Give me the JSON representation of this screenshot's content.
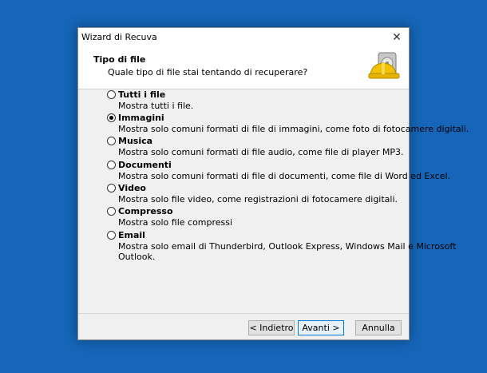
{
  "window": {
    "title": "Wizard di Recuva",
    "close_glyph": "✕"
  },
  "header": {
    "title": "Tipo di file",
    "subtitle": "Quale tipo di file stai tentando di recuperare?",
    "logo_icon": "recuva-hard-drive-helmet-icon"
  },
  "options": [
    {
      "label": "Tutti i file",
      "desc": "Mostra tutti i file.",
      "selected": false
    },
    {
      "label": "Immagini",
      "desc": "Mostra solo comuni formati di file di immagini, come foto di fotocamere digitali.",
      "selected": true
    },
    {
      "label": "Musica",
      "desc": "Mostra solo comuni formati di file audio, come file di player MP3.",
      "selected": false
    },
    {
      "label": "Documenti",
      "desc": "Mostra solo comuni formati di file di documenti, come file di Word ed Excel.",
      "selected": false
    },
    {
      "label": "Video",
      "desc": "Mostra solo file video, come registrazioni di fotocamere digitali.",
      "selected": false
    },
    {
      "label": "Compresso",
      "desc": "Mostra solo file compressi",
      "selected": false
    },
    {
      "label": "Email",
      "desc": "Mostra solo email di Thunderbird, Outlook Express, Windows Mail e Microsoft",
      "desc2": "Outlook.",
      "selected": false
    }
  ],
  "buttons": {
    "back": "< Indietro",
    "next": "Avanti >",
    "cancel": "Annulla"
  },
  "colors": {
    "desktop": "#1565b8",
    "dialog": "#f0f0f0",
    "accent": "#0078d7"
  }
}
